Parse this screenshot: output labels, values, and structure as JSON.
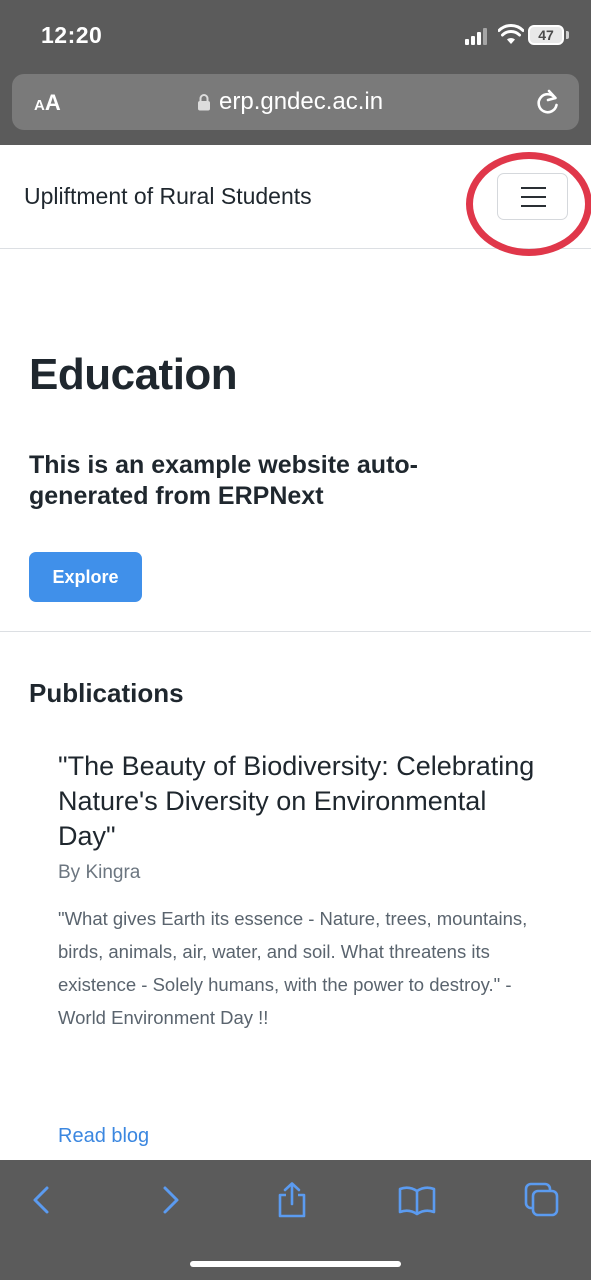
{
  "status_bar": {
    "time": "12:20",
    "battery": "47"
  },
  "browser": {
    "text_size_small": "A",
    "text_size_big": "A",
    "url": "erp.gndec.ac.in"
  },
  "navbar": {
    "brand": "Upliftment of Rural Students"
  },
  "hero": {
    "title": "Education",
    "subtitle": "This is an example website auto-generated from ERPNext",
    "button_label": "Explore"
  },
  "publications": {
    "heading": "Publications",
    "post": {
      "title": "\"The Beauty of Biodiversity: Celebrating Nature's Diversity on Environmental Day\"",
      "author": "By Kingra",
      "excerpt": "\"What gives Earth its essence - Nature, trees, mountains, birds, animals, air, water, and soil. What threatens its existence - Solely humans, with the power to destroy.\" - World Environment Day !!",
      "link_label": "Read blog"
    }
  },
  "colors": {
    "chrome": "#5b5b5b",
    "accent": "#4090ea",
    "link": "#3b87e0",
    "highlight": "#e0374a",
    "toolbar_icons": "#5b9bf0"
  },
  "icons": [
    "lock-icon",
    "reload-icon",
    "hamburger-menu-icon",
    "back-icon",
    "forward-icon",
    "share-icon",
    "bookmarks-icon",
    "tabs-icon"
  ]
}
